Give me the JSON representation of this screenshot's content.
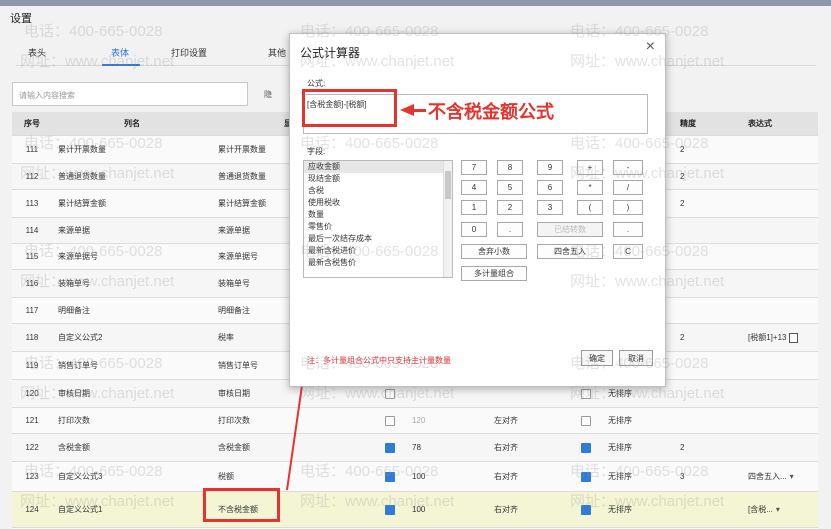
{
  "page": {
    "title": "设置"
  },
  "tabs": [
    {
      "label": "表头"
    },
    {
      "label": "表体"
    },
    {
      "label": "打印设置"
    },
    {
      "label": "其他"
    }
  ],
  "search": {
    "placeholder": "请输入内容搜索"
  },
  "toolbar": {
    "hidden_label": "隐"
  },
  "table": {
    "headers": {
      "seq": "序号",
      "name": "列名",
      "display": "显示",
      "precision": "精度",
      "expr": "表达式"
    },
    "rows": [
      {
        "seq": "111",
        "name": "累计开票数量",
        "display": "累计开票数量",
        "chk1": false,
        "width": "",
        "align": "",
        "chk2": false,
        "sort": "",
        "precision": "2",
        "expr": ""
      },
      {
        "seq": "112",
        "name": "普通退货数量",
        "display": "普通退货数量",
        "chk1": false,
        "width": "",
        "align": "",
        "chk2": false,
        "sort": "",
        "precision": "2",
        "expr": ""
      },
      {
        "seq": "113",
        "name": "累计结算金额",
        "display": "累计结算金额",
        "chk1": false,
        "width": "",
        "align": "",
        "chk2": false,
        "sort": "",
        "precision": "2",
        "expr": ""
      },
      {
        "seq": "114",
        "name": "来源单据",
        "display": "来源单据",
        "chk1": false,
        "width": "",
        "align": "",
        "chk2": false,
        "sort": "",
        "precision": "",
        "expr": ""
      },
      {
        "seq": "115",
        "name": "来源单据号",
        "display": "来源单据号",
        "chk1": false,
        "width": "",
        "align": "",
        "chk2": false,
        "sort": "",
        "precision": "",
        "expr": ""
      },
      {
        "seq": "116",
        "name": "装箱单号",
        "display": "装箱单号",
        "chk1": false,
        "width": "",
        "align": "",
        "chk2": false,
        "sort": "",
        "precision": "",
        "expr": ""
      },
      {
        "seq": "117",
        "name": "明细备注",
        "display": "明细备注",
        "chk1": false,
        "width": "",
        "align": "",
        "chk2": false,
        "sort": "",
        "precision": "",
        "expr": ""
      },
      {
        "seq": "118",
        "name": "自定义公式2",
        "display": "税率",
        "chk1": false,
        "width": "",
        "align": "",
        "chk2": false,
        "sort": "",
        "precision": "2",
        "expr": "[税额1]+13"
      },
      {
        "seq": "119",
        "name": "销售订单号",
        "display": "销售订单号",
        "chk1": false,
        "width": "",
        "align": "",
        "chk2": false,
        "sort": "",
        "precision": "",
        "expr": ""
      },
      {
        "seq": "120",
        "name": "审核日期",
        "display": "审核日期",
        "chk1": false,
        "width": "",
        "align": "",
        "chk2": false,
        "sort": "无排序",
        "precision": "",
        "expr": ""
      },
      {
        "seq": "121",
        "name": "打印次数",
        "display": "打印次数",
        "chk1": false,
        "width": "120",
        "align": "左对齐",
        "chk2": false,
        "sort": "无排序",
        "precision": "",
        "expr": ""
      },
      {
        "seq": "122",
        "name": "含税金额",
        "display": "含税金额",
        "chk1": true,
        "width": "78",
        "align": "右对齐",
        "chk2": true,
        "sort": "无排序",
        "precision": "2",
        "expr": ""
      },
      {
        "seq": "123",
        "name": "自定义公式3",
        "display": "税额",
        "chk1": true,
        "width": "100",
        "align": "右对齐",
        "chk2": true,
        "sort": "无排序",
        "precision": "3",
        "expr": "四舍五入..."
      },
      {
        "seq": "124",
        "name": "自定义公式1",
        "display": "不含税金额",
        "chk1": true,
        "width": "100",
        "align": "右对齐",
        "chk2": true,
        "sort": "无排序",
        "precision": "",
        "expr": "[含税..."
      }
    ]
  },
  "dialog": {
    "title": "公式计算器",
    "close": "×",
    "formula_label": "公式:",
    "formula_value": "[含税金额]-[税额]",
    "annotation": "不含税金额公式",
    "field_label": "字段:",
    "fields": [
      "应收金额",
      "现结金额",
      "含税",
      "使用税收",
      "数量",
      "零售价",
      "最后一次结存成本",
      "最新含税进价",
      "最新含税售价"
    ],
    "keys": {
      "row1": [
        "7",
        "8",
        "9",
        "+",
        "-"
      ],
      "row2": [
        "4",
        "5",
        "6",
        "*",
        "/"
      ],
      "row3": [
        "1",
        "2",
        "3",
        "(",
        ")"
      ],
      "row4": [
        "0",
        ".",
        "已结转数",
        "."
      ],
      "row5": [
        "舍弃小数",
        "四舍五入",
        "C"
      ],
      "row6": [
        "多计量组合"
      ]
    },
    "note": "注：多计量组合公式中只支持主计量数量",
    "ok": "确定",
    "cancel": "取消"
  },
  "watermarks": {
    "phone": "电话：400-665-0028",
    "site": "网址：www.chanjet.net"
  }
}
